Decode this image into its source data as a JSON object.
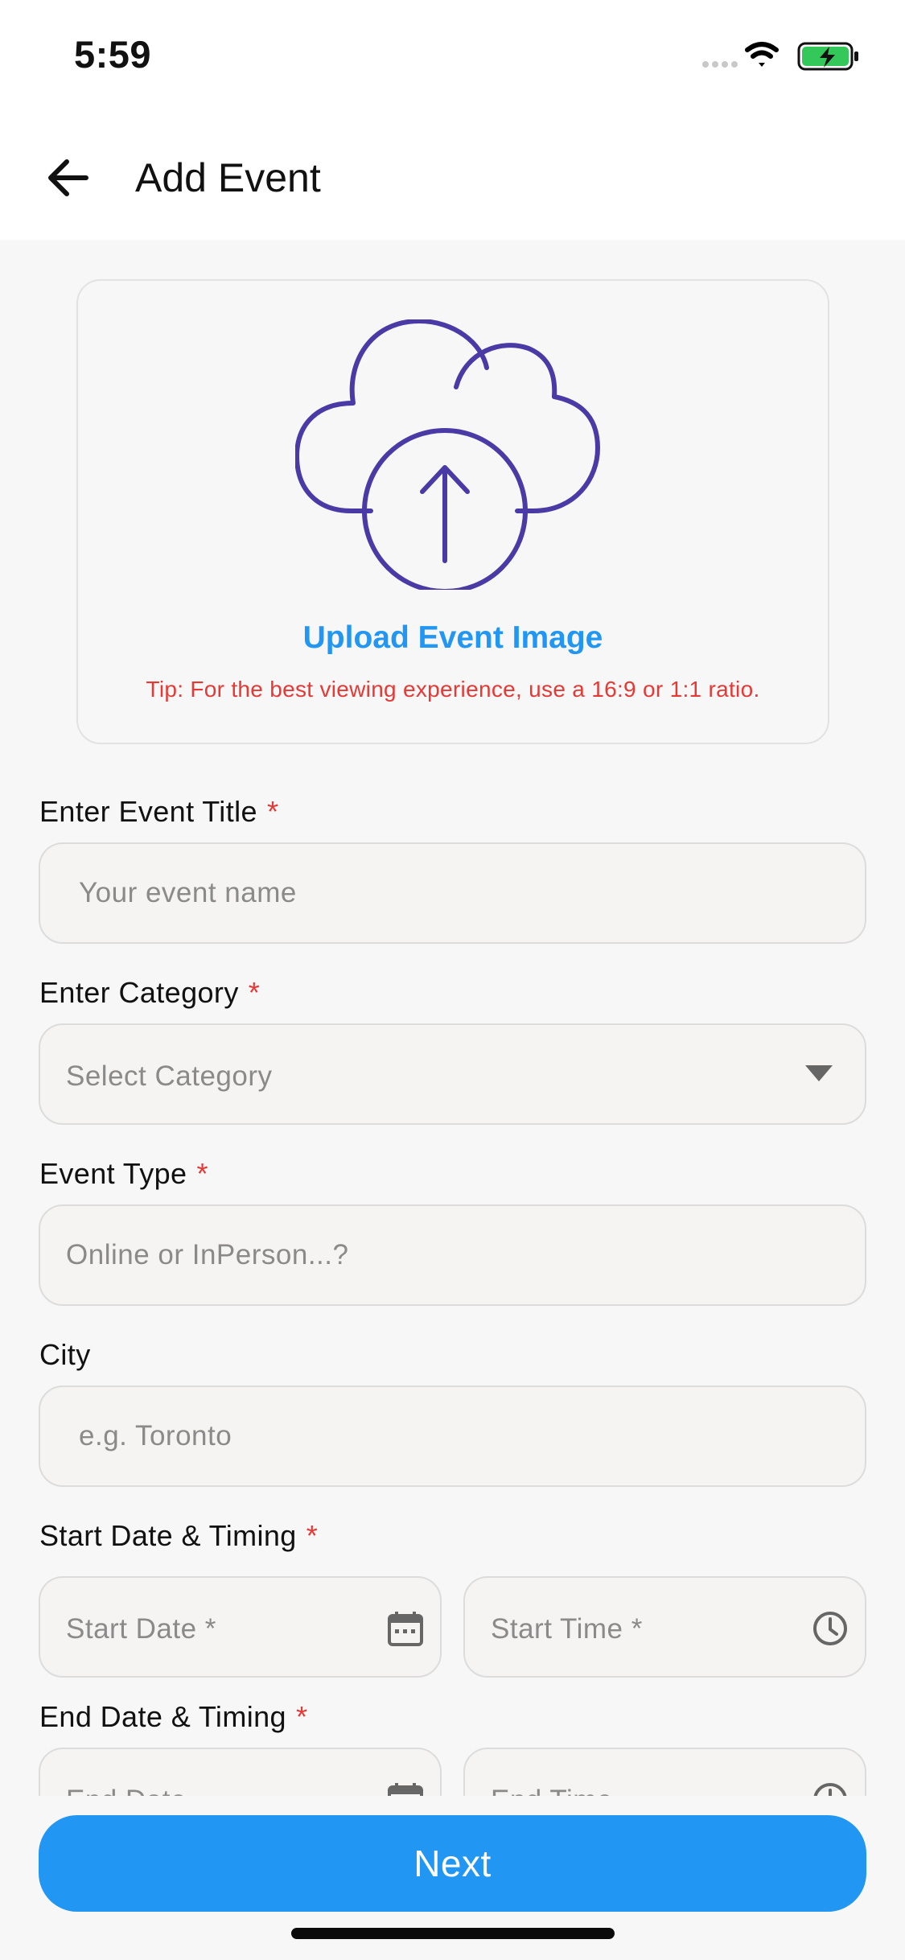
{
  "status_bar": {
    "time": "5:59"
  },
  "app_bar": {
    "title": "Add Event"
  },
  "upload": {
    "label": "Upload Event Image",
    "tip": "Tip: For the best viewing experience, use a 16:9 or 1:1 ratio."
  },
  "fields": {
    "title": {
      "label": "Enter Event Title",
      "required": "*",
      "placeholder": "Your event name"
    },
    "category": {
      "label": "Enter Category",
      "required": "*",
      "placeholder": "Select Category"
    },
    "event_type": {
      "label": "Event Type",
      "required": "*",
      "placeholder": "Online or InPerson...?"
    },
    "city": {
      "label": "City",
      "placeholder": "e.g. Toronto"
    },
    "start": {
      "label": "Start Date & Timing",
      "required": "*",
      "date_placeholder": "Start Date *",
      "time_placeholder": "Start Time *"
    },
    "end": {
      "label": "End Date & Timing",
      "required": "*",
      "date_placeholder": "End Date",
      "time_placeholder": "End Time"
    }
  },
  "actions": {
    "next_label": "Next"
  },
  "colors": {
    "accent": "#2196f3",
    "icon_purple": "#4a3aa5",
    "required_red": "#e53935",
    "battery_green": "#34c759"
  },
  "icons": {
    "back": "arrow-left-icon",
    "upload": "cloud-upload-icon",
    "dropdown": "caret-down-icon",
    "date": "calendar-icon",
    "time": "clock-icon"
  }
}
